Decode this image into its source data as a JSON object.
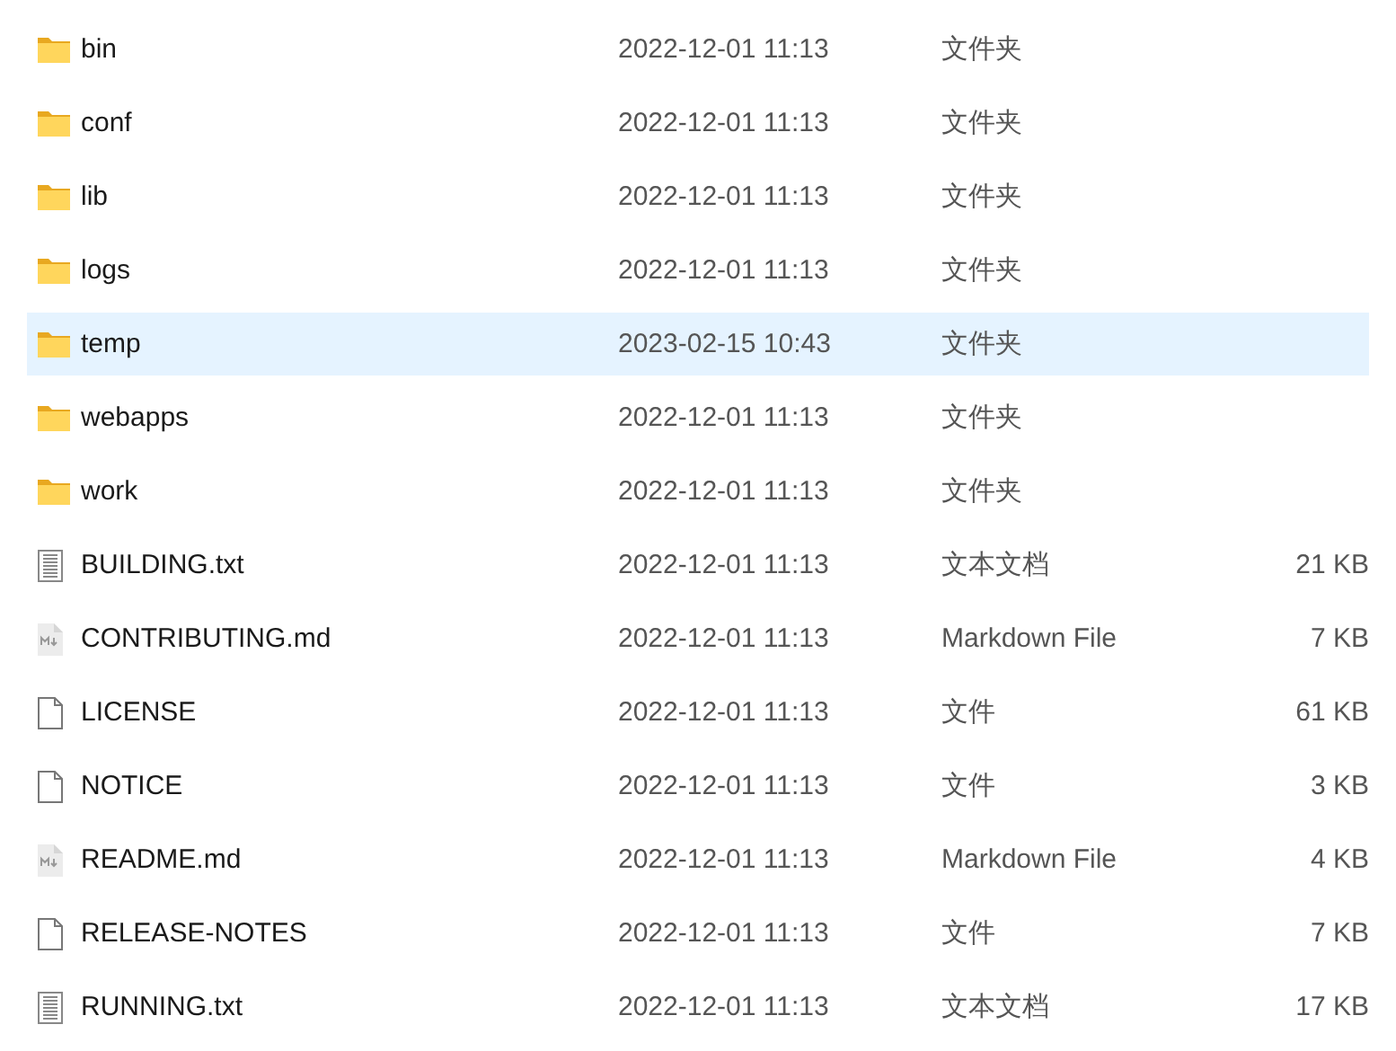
{
  "files": [
    {
      "name": "bin",
      "modified": "2022-12-01 11:13",
      "type": "文件夹",
      "kind": "folder",
      "selected": false
    },
    {
      "name": "conf",
      "modified": "2022-12-01 11:13",
      "type": "文件夹",
      "kind": "folder",
      "selected": false
    },
    {
      "name": "lib",
      "modified": "2022-12-01 11:13",
      "type": "文件夹",
      "kind": "folder",
      "selected": false
    },
    {
      "name": "logs",
      "modified": "2022-12-01 11:13",
      "type": "文件夹",
      "kind": "folder",
      "selected": false
    },
    {
      "name": "temp",
      "modified": "2023-02-15 10:43",
      "type": "文件夹",
      "kind": "folder",
      "selected": true
    },
    {
      "name": "webapps",
      "modified": "2022-12-01 11:13",
      "type": "文件夹",
      "kind": "folder",
      "selected": false
    },
    {
      "name": "work",
      "modified": "2022-12-01 11:13",
      "type": "文件夹",
      "kind": "folder",
      "selected": false
    },
    {
      "name": "BUILDING.txt",
      "modified": "2022-12-01 11:13",
      "type": "文本文档",
      "size": "21 KB",
      "kind": "text",
      "selected": false
    },
    {
      "name": "CONTRIBUTING.md",
      "modified": "2022-12-01 11:13",
      "type": "Markdown File",
      "size": "7 KB",
      "kind": "markdown",
      "selected": false
    },
    {
      "name": "LICENSE",
      "modified": "2022-12-01 11:13",
      "type": "文件",
      "size": "61 KB",
      "kind": "file",
      "selected": false
    },
    {
      "name": "NOTICE",
      "modified": "2022-12-01 11:13",
      "type": "文件",
      "size": "3 KB",
      "kind": "file",
      "selected": false
    },
    {
      "name": "README.md",
      "modified": "2022-12-01 11:13",
      "type": "Markdown File",
      "size": "4 KB",
      "kind": "markdown",
      "selected": false
    },
    {
      "name": "RELEASE-NOTES",
      "modified": "2022-12-01 11:13",
      "type": "文件",
      "size": "7 KB",
      "kind": "file",
      "selected": false
    },
    {
      "name": "RUNNING.txt",
      "modified": "2022-12-01 11:13",
      "type": "文本文档",
      "size": "17 KB",
      "kind": "text",
      "selected": false
    }
  ]
}
